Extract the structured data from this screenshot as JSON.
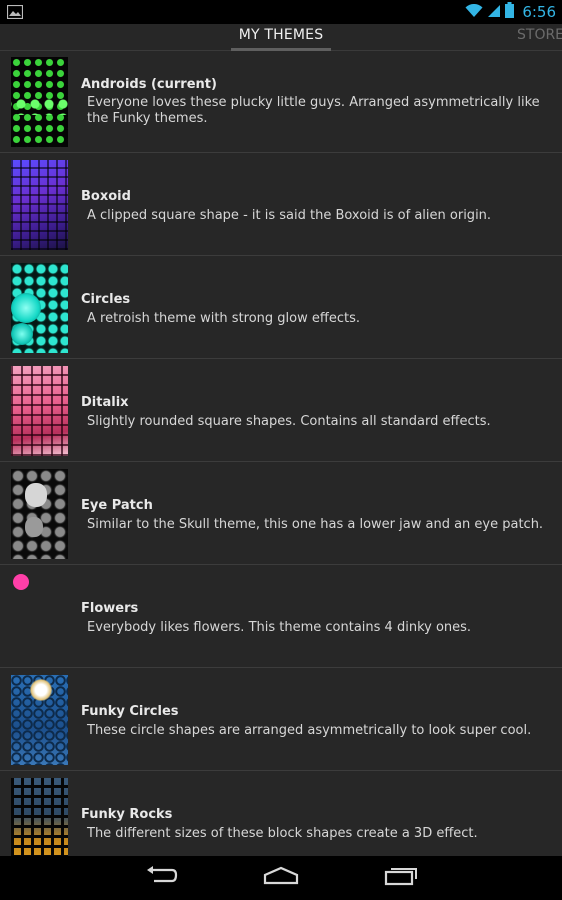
{
  "status": {
    "time": "6:56",
    "accent": "#33b5e5"
  },
  "tabs": {
    "my_themes": "MY THEMES",
    "store": "STORE"
  },
  "themes": [
    {
      "title": "Androids (current)",
      "description": "Everyone loves these plucky little guys. Arranged asymmetrically like the Funky themes."
    },
    {
      "title": "Boxoid",
      "description": "A clipped square shape - it is said the Boxoid is of alien origin."
    },
    {
      "title": "Circles",
      "description": "A retroish theme with strong glow effects."
    },
    {
      "title": "Ditalix",
      "description": "Slightly rounded square shapes. Contains all standard effects."
    },
    {
      "title": "Eye Patch",
      "description": "Similar to the Skull theme, this one has a lower jaw and an eye patch."
    },
    {
      "title": "Flowers",
      "description": "Everybody likes flowers. This theme contains 4 dinky ones."
    },
    {
      "title": "Funky Circles",
      "description": "These circle shapes are arranged asymmetrically to look super cool."
    },
    {
      "title": "Funky Rocks",
      "description": "The different sizes of these block shapes create a 3D effect."
    }
  ],
  "nav": {
    "back_icon": "back-icon",
    "home_icon": "home-icon",
    "recents_icon": "recent-apps-icon"
  }
}
